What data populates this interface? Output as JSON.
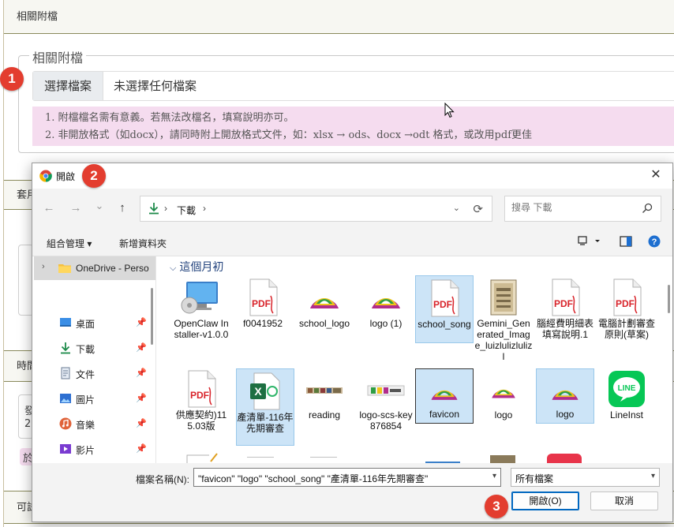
{
  "page": {
    "section_attachments": "相關附檔",
    "legend": "相關附檔",
    "file_button": "選擇檔案",
    "file_status": "未選擇任何檔案",
    "notes": [
      "1. 附檔檔名需有意義。若無法改檔名，填寫說明亦可。",
      "2. 非開放格式（如docx），請同時附上開放格式文件，如：xlsx → ods、docx →odt 格式，或改用pdf更佳"
    ],
    "section_suite": "套用",
    "section_time": "時間",
    "fragment_a": "發",
    "fragment_b": "2",
    "fragment_c": "於",
    "section_license": "可試"
  },
  "annotations": {
    "step1": "1",
    "step2": "2",
    "step3": "3"
  },
  "dialog": {
    "title": "開啟",
    "close": "✕",
    "nav": {
      "back": "←",
      "forward": "→",
      "recent": "⌄",
      "up": "↑",
      "refresh": "⟳"
    },
    "address": {
      "separator": "›",
      "location": "下載",
      "after": "›"
    },
    "search_placeholder": "搜尋 下載",
    "toolbar": {
      "organize": "組合管理 ▾",
      "new_folder": "新增資料夾"
    },
    "sidebar": {
      "onedrive": "OneDrive - Perso",
      "items": [
        {
          "label": "桌面",
          "icon": "desktop-icon"
        },
        {
          "label": "下載",
          "icon": "download-icon"
        },
        {
          "label": "文件",
          "icon": "documents-icon"
        },
        {
          "label": "圖片",
          "icon": "pictures-icon"
        },
        {
          "label": "音樂",
          "icon": "music-icon"
        },
        {
          "label": "影片",
          "icon": "videos-icon"
        }
      ]
    },
    "group_header": "這個月初",
    "files": [
      {
        "name": "OpenClaw Installer-v1.0.0",
        "type": "installer",
        "selected": false
      },
      {
        "name": "f0041952",
        "type": "pdf",
        "selected": false
      },
      {
        "name": "school_logo",
        "type": "logo",
        "selected": false
      },
      {
        "name": "logo (1)",
        "type": "logo",
        "selected": false
      },
      {
        "name": "school_song",
        "type": "pdf",
        "selected": true
      },
      {
        "name": "Gemini_Generated_Image_luizlulizlulizl",
        "type": "image",
        "selected": false
      },
      {
        "name": "腦經費明細表填寫說明.1",
        "type": "pdf",
        "selected": false
      },
      {
        "name": "電腦計劃審查原則(草案)",
        "type": "pdf",
        "selected": false
      },
      {
        "name": "供應契約)115.03版",
        "type": "pdf",
        "selected": false
      },
      {
        "name": "產清單-116年先期審查",
        "type": "excel",
        "selected": true
      },
      {
        "name": "reading",
        "type": "strip",
        "selected": false
      },
      {
        "name": "logo-scs-key876854",
        "type": "strip2",
        "selected": false
      },
      {
        "name": "favicon",
        "type": "favicon",
        "selected": true
      },
      {
        "name": "logo",
        "type": "logo-small",
        "selected": false
      },
      {
        "name": "logo",
        "type": "logo",
        "selected": true
      },
      {
        "name": "LineInst",
        "type": "line",
        "selected": false
      }
    ],
    "filename_label": "檔案名稱(N):",
    "filename_value": "\"favicon\" \"logo\" \"school_song\" \"產清單-116年先期審查\"",
    "filetype": "所有檔案",
    "open_button": "開啟(O)",
    "cancel_button": "取消"
  },
  "colors": {
    "badge": "#e33d2f",
    "selection": "#cce4f7",
    "accent": "#0067c0",
    "note_bg": "#f5dcef"
  }
}
